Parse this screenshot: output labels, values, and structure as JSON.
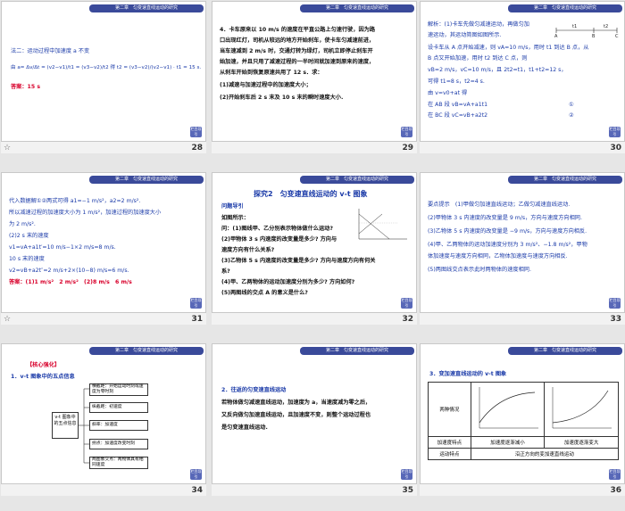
{
  "header": "第二章　匀变速直线运动的研究",
  "nav_button": "栏目导引",
  "slides": [
    {
      "num": "28",
      "lines": [
        "法二：运动过程中加速度 a 不变",
        "由 a= Δv/Δt = (v2−v1)/t1 = (v3−v2)/t2 得 t2 = (v3−v2)/(v2−v1) · t1 = 15 s.",
        "答案：15 s"
      ]
    },
    {
      "num": "29",
      "lines": [
        "4．卡车原来以 10 m/s 的速度在平直公路上匀速行驶，因为路",
        "口出现红灯，司机从较远的地方开始刹车，使卡车匀减速前进，",
        "当车速减到 2 m/s 时，交通灯转为绿灯，司机立即停止刹车开",
        "始加速，并且只用了减速过程的一半时间就加速到原来的速度，",
        "从刹车开始到恢复原速共用了 12 s．求：",
        "(1)减速与加速过程中的加速度大小；",
        "(2)开始刹车后 2 s 末及 10 s 末的瞬时速度大小."
      ]
    },
    {
      "num": "30",
      "lines": [
        "解析：(1)卡车先做匀减速运动，再做匀加",
        "速运动，其运动简图如图所示.",
        "设卡车从 A 点开始减速，则 vA=10 m/s，用时 t1 到达 B 点，从",
        "B 点又开始加速，用时 t2 到达 C 点，则",
        "vB=2 m/s，vC=10 m/s，且 2t2=t1，t1+t2=12 s，",
        "可得 t1=8 s，t2=4 s.",
        "由 v=v0+at 得",
        "在 AB 段 vB=vA+a1t1",
        "在 BC 段 vC=vB+a2t2"
      ],
      "figure_labels": {
        "t1": "t1",
        "t2": "t2",
        "A": "A",
        "B": "B",
        "C": "C"
      },
      "eq_marks": [
        "①",
        "②"
      ]
    },
    {
      "num": "31",
      "lines": [
        "代入数据解①②两式可得 a1=−1 m/s²，a2=2 m/s².",
        "所以减速过程的加速度大小为 1 m/s²，加速过程的加速度大小",
        "为 2 m/s².",
        "(2)2 s 末的速度",
        "v1=vA+a1t′=10 m/s−1×2 m/s=8 m/s.",
        "10 s 末的速度",
        "v2=vB+a2t″=2 m/s+2×(10−8) m/s=6 m/s.",
        "答案：(1)1 m/s²　2 m/s²　(2)8 m/s　6 m/s"
      ]
    },
    {
      "num": "32",
      "title": "探究2　匀变速直线运动的 v-t 图象",
      "subtitle": "问题导引",
      "lines": [
        "如图所示：",
        "问：(1)图线甲、乙分别表示物体做什么运动?",
        "(2)甲物体 3 s 内速度的改变量是多少? 方向与",
        "速度方向有什么关系?",
        "(3)乙物体 5 s 内速度的改变量是多少? 方向与速度方向有何关",
        "系?",
        "(4)甲、乙两物体的运动加速度分别为多少? 方向如何?",
        "(5)两图线的交点 A 的意义是什么?"
      ]
    },
    {
      "num": "33",
      "lines": [
        "要点提示　(1)甲做匀加速直线运动；乙做匀减速直线运动.",
        "(2)甲物体 3 s 内速度的改变量是 9 m/s，方向与速度方向相同.",
        "(3)乙物体 5 s 内速度的改变量是 −9 m/s，方向与速度方向相反.",
        "(4)甲、乙两物体的运动加速度分别为 3 m/s²、−1.8 m/s²，甲物",
        "体加速度与速度方向相同，乙物体加速度与速度方向相反.",
        "(5)两图线交点表示此时两物体的速度相同."
      ]
    },
    {
      "num": "34",
      "title": "【核心强化】",
      "subtitle": "1．v-t 图象中的五点信息",
      "center": "v-t 图象中的五点信息",
      "items": [
        "横截距：开始运动时刻或速度为零时刻",
        "纵截距：初速度",
        "斜率：加速度",
        "拐点：加速度改变时刻",
        "两图象交点：两物体具有相同速度"
      ]
    },
    {
      "num": "35",
      "lines": [
        "2．往返的匀变速直线运动",
        "若物体做匀减速直线运动，加速度为 a，当速度减为零之后，",
        "又反向做匀加速直线运动，且加速度不变，则整个运动过程也",
        "是匀变速直线运动."
      ]
    },
    {
      "num": "36",
      "title": "3．变加速直线运动的 v-t 图象",
      "table": {
        "row1": "两种情况",
        "row2": "加速度特点",
        "row3": "运动特点",
        "a_cell": "加速度逐渐减小",
        "b_cell": "加速度逐渐变大",
        "motion": "沿正方向的变加速直线运动"
      }
    }
  ]
}
